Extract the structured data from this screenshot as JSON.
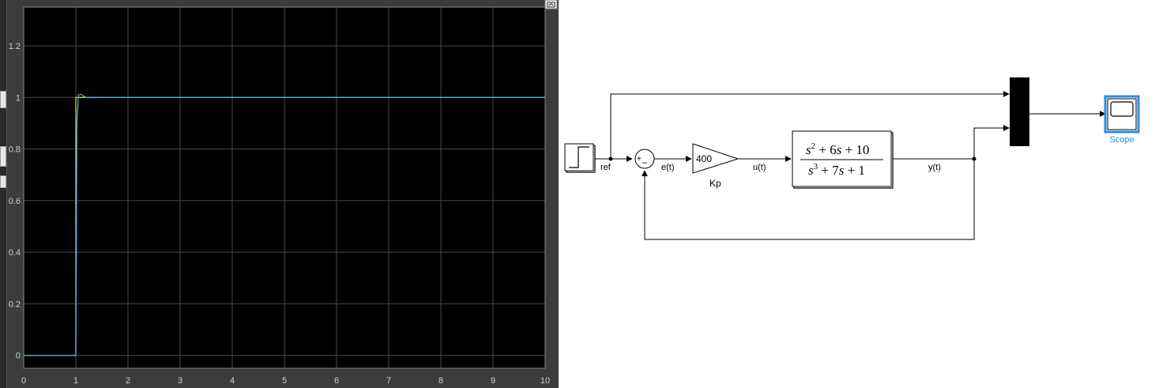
{
  "scope": {
    "x_ticks": [
      "0",
      "1",
      "2",
      "3",
      "4",
      "5",
      "6",
      "7",
      "8",
      "9",
      "10"
    ],
    "y_ticks": [
      "0",
      "0.2",
      "0.4",
      "0.6",
      "0.8",
      "1",
      "1.2"
    ],
    "restore_icon": "restore-window-icon",
    "colors": {
      "background": "#000000",
      "grid": "#4a4a4a",
      "trace_reference": "#e8c93a",
      "trace_output": "#4aa8e8",
      "tick_text": "#cfcfcf"
    }
  },
  "chart_data": {
    "type": "line",
    "title": "",
    "xlabel": "",
    "ylabel": "",
    "xlim": [
      0,
      10
    ],
    "ylim": [
      -0.05,
      1.35
    ],
    "grid": true,
    "series": [
      {
        "color": "#e8c93a",
        "x": [
          0,
          1,
          1,
          10
        ],
        "y": [
          0,
          0,
          1,
          1
        ]
      },
      {
        "color": "#4aa8e8",
        "x": [
          0,
          1,
          1.02,
          1.05,
          1.1,
          1.15,
          1.2,
          1.3,
          1.5,
          10
        ],
        "y": [
          0,
          0,
          0.9,
          1.01,
          1.012,
          1.005,
          1.0,
          0.999,
          1.0,
          1.0
        ]
      }
    ]
  },
  "model": {
    "step_label": "ref",
    "sum_signs": [
      "+",
      "–"
    ],
    "error_label": "e(t)",
    "gain_value": "400",
    "gain_name": "Kp",
    "control_label": "u(t)",
    "tf_num_a": "s",
    "tf_num_b": "2",
    "tf_num_c": " + 6",
    "tf_num_d": "s",
    "tf_num_e": " + 10",
    "tf_den_a": "s",
    "tf_den_b": "3",
    "tf_den_c": " + 7",
    "tf_den_d": "s",
    "tf_den_e": " + 1",
    "output_label": "y(t)",
    "scope_name": "Scope",
    "colors": {
      "scope_selected": "#2b8fe0",
      "wire": "#000000"
    }
  }
}
